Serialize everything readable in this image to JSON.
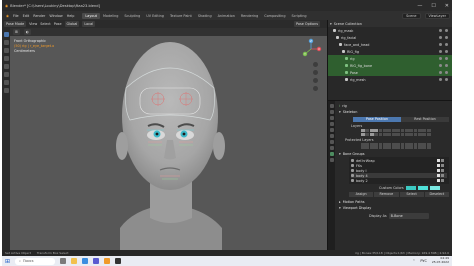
{
  "window": {
    "title": "Blender* [C:\\Users\\Loukiny\\Desktop\\ftaa23.blend]",
    "min": "—",
    "max": "☐",
    "close": "✕"
  },
  "menubar": {
    "items": [
      "File",
      "Edit",
      "Render",
      "Window",
      "Help"
    ],
    "workspaces": [
      "Layout",
      "Modeling",
      "Sculpting",
      "UV Editing",
      "Texture Paint",
      "Shading",
      "Animation",
      "Rendering",
      "Compositing",
      "Scripting"
    ],
    "active_workspace": "Layout",
    "scene": "Scene",
    "view_layer": "ViewLayer"
  },
  "toolbar": {
    "mode": "Pose Mode",
    "view": "View",
    "select": "Select",
    "pose": "Pose",
    "orientation": "Global",
    "pivot": "Local",
    "pose_options": "Pose Options"
  },
  "viewport": {
    "info_line1": "Front Orthographic",
    "info_line2": "(50) rig | r_eye_target.o",
    "info_line3": "Centimeters",
    "gizmo": {
      "x": "X",
      "y": "Y",
      "z": "Z"
    }
  },
  "outliner": {
    "header": "Scene Collection",
    "rows": [
      {
        "label": "Scene Collection",
        "sel": false
      },
      {
        "label": "rig_mask",
        "sel": false
      },
      {
        "label": "rig_facial",
        "sel": false
      },
      {
        "label": "face_and_head",
        "sel": false
      },
      {
        "label": "RIG_fig",
        "sel": false
      },
      {
        "label": "rig",
        "sel": true
      },
      {
        "label": "RIG_fig_bone",
        "sel": true
      },
      {
        "label": "Pose",
        "sel": true
      },
      {
        "label": "rig_mesh",
        "sel": false
      }
    ]
  },
  "properties": {
    "object_name": "rig",
    "skeleton_label": "Skeleton",
    "pose_position": "Pose Position",
    "rest_position": "Rest Position",
    "layers_label": "Layers",
    "protected_label": "Protected Layers",
    "bone_groups_label": "Bone Groups",
    "bone_groups": [
      {
        "name": "def.hrWrap",
        "sel": false
      },
      {
        "name": "FKs",
        "sel": false
      },
      {
        "name": "body I",
        "sel": false
      },
      {
        "name": "body 4",
        "sel": true
      },
      {
        "name": "body 2",
        "sel": false
      }
    ],
    "color_set_label": "Custom Colors",
    "assign": "Assign",
    "remove": "Remove",
    "select": "Select",
    "deselect": "Deselect",
    "action_paths": "Motion Paths",
    "viewport_display": "Viewport Display",
    "display_as_label": "Display As",
    "display_as": "B-Bone"
  },
  "statusbar": {
    "left": "Set Active Object",
    "mid": "Transform Box Select",
    "right": "rig | Bones:35/118 | Objects:1/63 | Memory: 169.4 MiB | 2.92.0"
  },
  "taskbar": {
    "search": "Поиск",
    "lang": "РУС",
    "time": "04:49",
    "date": "25.07.2022"
  },
  "colors": {
    "accent": "#4c78b0",
    "select": "#f09a2a",
    "green": "#2f5f2f"
  }
}
